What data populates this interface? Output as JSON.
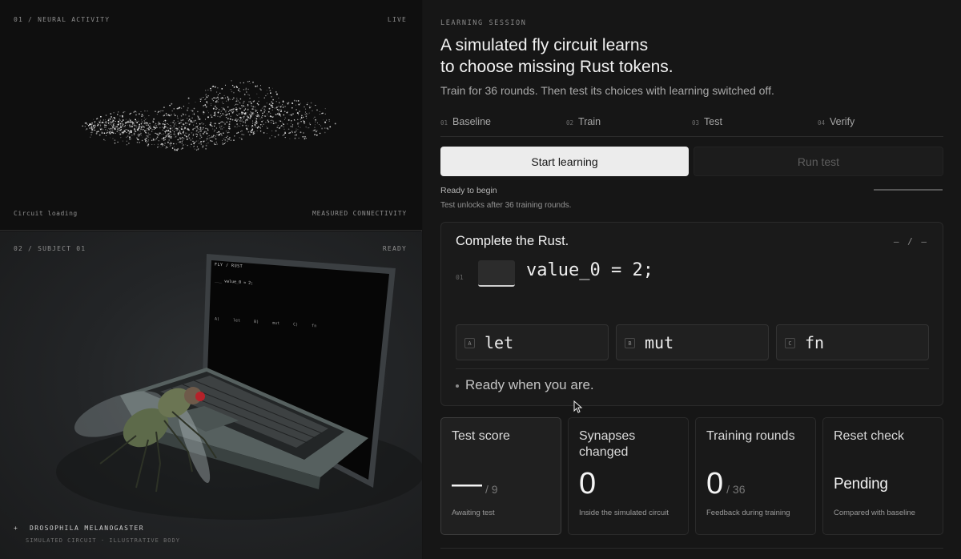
{
  "neural_panel": {
    "index_label": "01 / NEURAL ACTIVITY",
    "live_label": "LIVE",
    "status_label": "Circuit loading",
    "corner_label": "MEASURED CONNECTIVITY"
  },
  "subject_panel": {
    "index_label": "02 / SUBJECT 01",
    "status_label": "READY",
    "species_label": "DROSOPHILA MELANOGASTER",
    "caption": "SIMULATED CIRCUIT · ILLUSTRATIVE BODY",
    "screen_title": "FLY / RUST",
    "screen_code": "___ value_0 = 2;",
    "screen_options": [
      "A) let",
      "B) mut",
      "C) fn"
    ]
  },
  "session": {
    "eyebrow": "LEARNING SESSION",
    "title_line1": "A simulated fly circuit learns",
    "title_line2": "to choose missing Rust tokens.",
    "subtitle": "Train for 36 rounds. Then test its choices with learning switched off."
  },
  "steps": [
    {
      "num": "01",
      "label": "Baseline"
    },
    {
      "num": "02",
      "label": "Train"
    },
    {
      "num": "03",
      "label": "Test"
    },
    {
      "num": "04",
      "label": "Verify"
    }
  ],
  "actions": {
    "start_label": "Start learning",
    "test_label": "Run test"
  },
  "status": {
    "line1": "Ready to begin",
    "line2": "Test unlocks after 36 training rounds.",
    "progress": 0
  },
  "quiz": {
    "title": "Complete the Rust.",
    "counter": "– / –",
    "line_number": "01",
    "code": "value_0 = 2;",
    "options": [
      {
        "key": "A",
        "value": "let"
      },
      {
        "key": "B",
        "value": "mut"
      },
      {
        "key": "C",
        "value": "fn"
      }
    ],
    "prompt": "Ready when you are."
  },
  "stats": [
    {
      "label": "Test score",
      "value": "—",
      "of": "/ 9",
      "foot": "Awaiting test"
    },
    {
      "label": "Synapses changed",
      "value": "0",
      "foot": "Inside the simulated circuit"
    },
    {
      "label": "Training rounds",
      "value": "0",
      "of": "/ 36",
      "foot": "Feedback during training"
    },
    {
      "label": "Reset check",
      "value": "Pending",
      "foot": "Compared with baseline"
    }
  ]
}
